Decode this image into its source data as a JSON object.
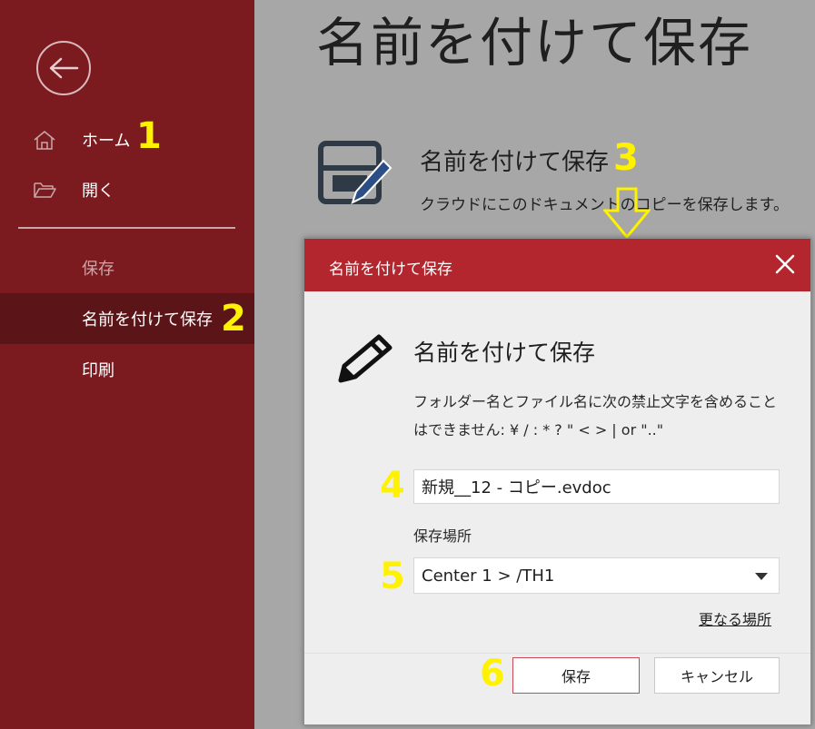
{
  "sidebar": {
    "home_label": "ホーム",
    "open_label": "開く",
    "save_label": "保存",
    "save_as_label": "名前を付けて保存",
    "print_label": "印刷"
  },
  "main": {
    "title": "名前を付けて保存",
    "option_title": "名前を付けて保存",
    "option_desc": "クラウドにこのドキュメントのコピーを保存します。"
  },
  "dialog": {
    "header_title": "名前を付けて保存",
    "title": "名前を付けて保存",
    "desc_line1": "フォルダー名とファイル名に次の禁止文字を含めること",
    "desc_line2": "はできません: ¥ / : * ? \" < > | or \"..\"",
    "filename_value": "新規__12 - コピー.evdoc",
    "location_label": "保存場所",
    "location_value": "Center 1 > /TH1",
    "more_locations": "更なる場所",
    "save_button": "保存",
    "cancel_button": "キャンセル"
  },
  "steps": [
    "1",
    "2",
    "3",
    "4",
    "5",
    "6"
  ],
  "colors": {
    "sidebar": "#7b1b20",
    "sidebar_active": "#5b1518",
    "dialog_header": "#b4262d",
    "annotation": "#fff200",
    "background": "#a7a7a7"
  }
}
